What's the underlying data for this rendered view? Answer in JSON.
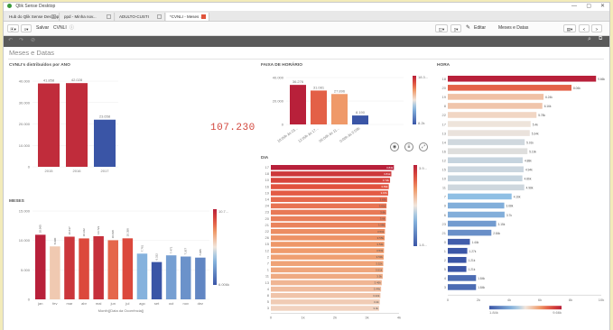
{
  "window": {
    "title": "Qlik Sense Desktop",
    "min": "—",
    "max": "▢",
    "close": "✕"
  },
  "tabs": [
    {
      "label": "Hub do Qlik Sense Desktop",
      "active": false
    },
    {
      "label": "ppd - Minha nov...",
      "active": false
    },
    {
      "label": "ADULTO-CUSTI",
      "active": false
    },
    {
      "label": "*CVNLI - Meses ...",
      "active": true
    }
  ],
  "toolbar": {
    "app_name": "Salvar",
    "doc": "CVNLI",
    "edit_label": "Editar",
    "sheet_name": "Meses e Datas"
  },
  "sheet": {
    "title": "Meses e Datas"
  },
  "kpi": {
    "value": "107.230"
  },
  "colors": {
    "red": "#c02c3b",
    "blue": "#3a55a6",
    "accent": "#e05a3a"
  },
  "charts": {
    "ano": {
      "title": "CVNLI's distribuídos por ANO",
      "yticks": [
        "40.000",
        "30.000",
        "20.000",
        "10.000",
        "0"
      ],
      "chart_data": {
        "type": "bar",
        "categories": [
          "2015",
          "2016",
          "2017"
        ],
        "values": [
          41858,
          42028,
          23658
        ],
        "labels": [
          "41.858",
          "42.028",
          "23.658"
        ],
        "ylim": [
          0,
          40000
        ]
      }
    },
    "faixa": {
      "title": "FAIXA DE HORÁRIO",
      "yticks": [
        "40.000",
        "20.000",
        "0"
      ],
      "legend_top": "18.3...",
      "legend_bottom": "8.2k",
      "chart_data": {
        "type": "bar",
        "categories": [
          "18:00h às 23...",
          "12:00h às 17...",
          "06:00h às 11...",
          "0:00h às 5:59h"
        ],
        "values": [
          36276,
          31081,
          27896,
          8190
        ],
        "labels": [
          "36.276",
          "31.081",
          "27.896",
          "8.190"
        ],
        "ylim": [
          0,
          40000
        ]
      }
    },
    "meses": {
      "title": "MESES",
      "xlabel": "Month([Data da Ocorrência])",
      "yticks": [
        "15.000",
        "10.000",
        "5.000",
        "0"
      ],
      "legend_top": "10.7...",
      "legend_bottom": "6.006k",
      "chart_data": {
        "type": "bar",
        "categories": [
          "jan",
          "fev",
          "mar",
          "abr",
          "mai",
          "jun",
          "jul",
          "ago",
          "set",
          "out",
          "nov",
          "dez"
        ],
        "values": [
          10965,
          8990,
          10637,
          10342,
          10723,
          10038,
          10358,
          7761,
          6332,
          7471,
          7267,
          7085
        ],
        "labels": [
          "10.965",
          "8.990",
          "10.637",
          "10.342",
          "10.723",
          "10.038",
          "10.358",
          "7.761",
          "6.332",
          "7.471",
          "7.267",
          "7.085"
        ],
        "ylim": [
          0,
          15000
        ]
      }
    },
    "dia": {
      "title": "DIA",
      "xticks": [
        "0",
        "1k",
        "2k",
        "3k",
        "4k"
      ],
      "legend_top": "3.9...",
      "legend_bottom": "1.8...",
      "chart_data": {
        "type": "bar",
        "categories": [
          "17",
          "18",
          "10",
          "16",
          "19",
          "14",
          "24",
          "23",
          "20",
          "21",
          "22",
          "26",
          "15",
          "12",
          "2",
          "7",
          "1",
          "11",
          "13",
          "4",
          "8",
          "5",
          "3"
        ],
        "values": [
          3840,
          3760,
          3720,
          3680,
          3660,
          3630,
          3610,
          3600,
          3590,
          3580,
          3560,
          3550,
          3540,
          3530,
          3520,
          3510,
          3500,
          3490,
          3460,
          3440,
          3420,
          3400,
          3380
        ],
        "labels": [
          "3.84k",
          "3.81k",
          "3.72k",
          "3.69k",
          "3.67k",
          "3.63k",
          "3.61k",
          "3.6k",
          "3.6k",
          "3.58k",
          "3.56k",
          "3.55k",
          "3.54k",
          "3.53k",
          "3.53k",
          "3.52k",
          "3.51k",
          "3.5k",
          "3.46k",
          "3.44k",
          "3.42k",
          "3.4k",
          "3.4k"
        ],
        "xlim": [
          0,
          4000
        ]
      }
    },
    "hora": {
      "title": "HORA",
      "xticks": [
        "0",
        "2k",
        "4k",
        "6k",
        "8k",
        "10k"
      ],
      "legend_left": "1.84k",
      "legend_right": "9.66k",
      "chart_data": {
        "type": "bar",
        "categories": [
          "18",
          "20",
          "19",
          "8",
          "22",
          "17",
          "13",
          "14",
          "16",
          "12",
          "15",
          "10",
          "11",
          "7",
          "9",
          "6",
          "23",
          "21",
          "0",
          "1",
          "2",
          "5",
          "4",
          "3"
        ],
        "values": [
          9660,
          8060,
          6240,
          6160,
          5780,
          5400,
          5340,
          5010,
          5190,
          4880,
          4940,
          4860,
          4980,
          4160,
          3680,
          3700,
          3150,
          2840,
          1440,
          1270,
          1210,
          1210,
          1840,
          1840
        ],
        "labels": [
          "9.66k",
          "8.06k",
          "6.24k",
          "6.16k",
          "5.78k",
          "5.4k",
          "5.34k",
          "5.01k",
          "5.19k",
          "4.88k",
          "4.94k",
          "4.86k",
          "4.98k",
          "4.16k",
          "3.68k",
          "3.7k",
          "3.15k",
          "2.84k",
          "1.44k",
          "1.27k",
          "1.21k",
          "1.21k",
          "1.84k",
          "1.84k"
        ],
        "xlim": [
          0,
          10000
        ]
      }
    }
  }
}
